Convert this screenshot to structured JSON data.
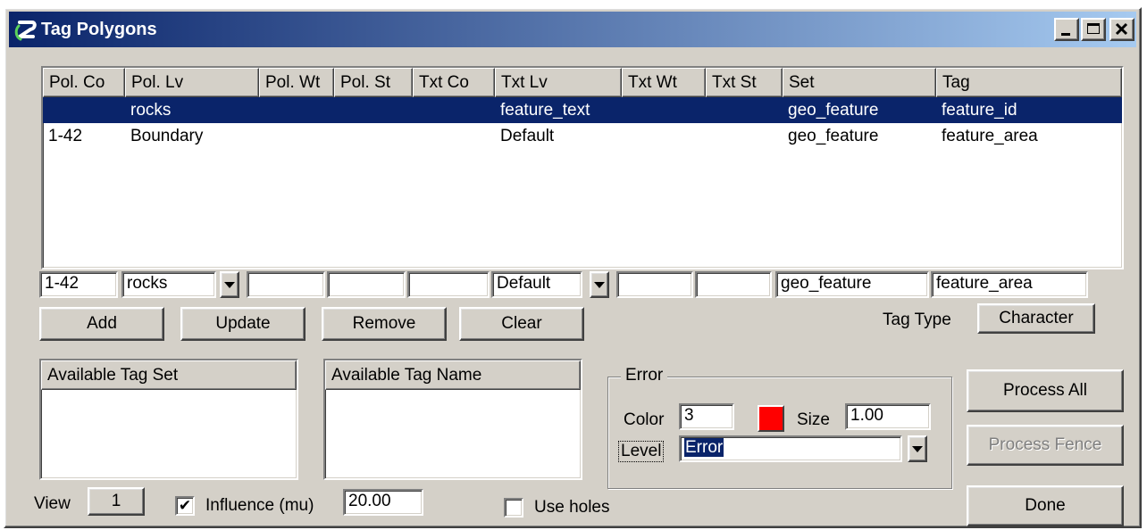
{
  "window": {
    "title": "Tag Polygons",
    "controls": {
      "minimize": "_",
      "maximize": "□",
      "close": "✕"
    }
  },
  "table": {
    "columns": [
      "Pol. Co",
      "Pol. Lv",
      "Pol. Wt",
      "Pol. St",
      "Txt Co",
      "Txt Lv",
      "Txt Wt",
      "Txt St",
      "Set",
      "Tag"
    ],
    "rows": [
      [
        "",
        "rocks",
        "",
        "",
        "",
        "feature_text",
        "",
        "",
        "geo_feature",
        "feature_id"
      ],
      [
        "1-42",
        "Boundary",
        "",
        "",
        "",
        "Default",
        "",
        "",
        "geo_feature",
        "feature_area"
      ]
    ],
    "selected_row": 0
  },
  "edit_row": {
    "pol_co": "1-42",
    "pol_lv": "rocks",
    "pol_wt": "",
    "pol_st": "",
    "txt_co": "",
    "txt_lv": "Default",
    "txt_wt": "",
    "txt_st": "",
    "set": "geo_feature",
    "tag": "feature_area"
  },
  "buttons": {
    "add": "Add",
    "update": "Update",
    "remove": "Remove",
    "clear": "Clear",
    "process_all": "Process All",
    "process_fence": "Process Fence",
    "done": "Done"
  },
  "tag_type": {
    "label": "Tag Type",
    "value": "Character"
  },
  "available_tag_set": {
    "header": "Available Tag Set",
    "items": []
  },
  "available_tag_name": {
    "header": "Available Tag Name",
    "items": []
  },
  "error_group": {
    "title": "Error",
    "color_label": "Color",
    "color_value": "3",
    "swatch_color": "#ff0000",
    "size_label": "Size",
    "size_value": "1.00",
    "level_label": "Level",
    "level_value": "Error"
  },
  "footer": {
    "view_label": "View",
    "view_value": "1",
    "influence_checked": true,
    "influence_label": "Influence (mu)",
    "influence_value": "20.00",
    "use_holes_checked": false,
    "use_holes_label": "Use holes"
  },
  "colors": {
    "title_gradient_start": "#0a246a",
    "title_gradient_end": "#a6caf0",
    "selection": "#0a246a",
    "face": "#d4d0c8"
  }
}
